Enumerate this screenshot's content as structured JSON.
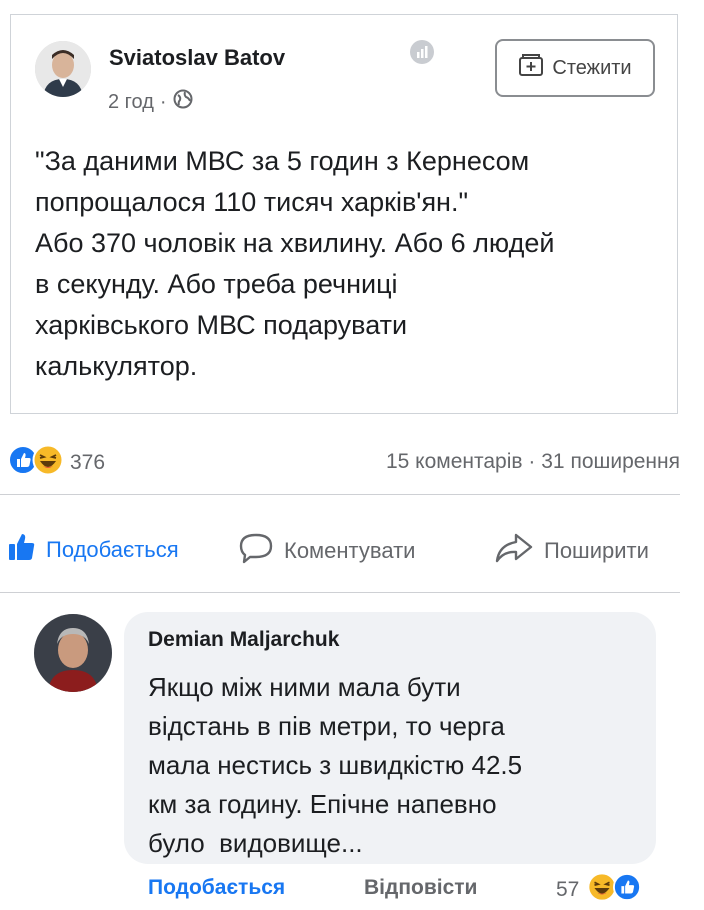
{
  "post": {
    "author": "Sviatoslav Batov",
    "time": "2 год",
    "separator": "·",
    "follow_label": "Стежити",
    "text_lines": [
      "\"За даними МВС за 5 годин з Кернесом",
      "попрощалося 110 тисяч харків'ян.\"",
      "Або 370 чоловік на хвилину. Або 6 людей",
      "в секунду. Або треба речниці",
      "харківського МВС подарувати",
      "калькулятор."
    ]
  },
  "reactions": {
    "count": "376",
    "comments": "15 коментарів",
    "dot": "·",
    "shares": "31 поширення"
  },
  "actions": {
    "like": "Подобається",
    "comment": "Коментувати",
    "share": "Поширити"
  },
  "comment": {
    "author": "Demian Maljarchuk",
    "text_lines": [
      "Якщо між ними мала бути",
      "відстань в пів метри, то черга",
      "мала нестись з швидкістю 42.5",
      "км за годину. Епічне напевно",
      "було  видовище..."
    ],
    "like_label": "Подобається",
    "reply_label": "Відповісти",
    "reaction_count": "57"
  },
  "colors": {
    "like_blue": "#1877f2",
    "haha_yellow": "#f7b928",
    "secondary_text": "#65676b"
  }
}
